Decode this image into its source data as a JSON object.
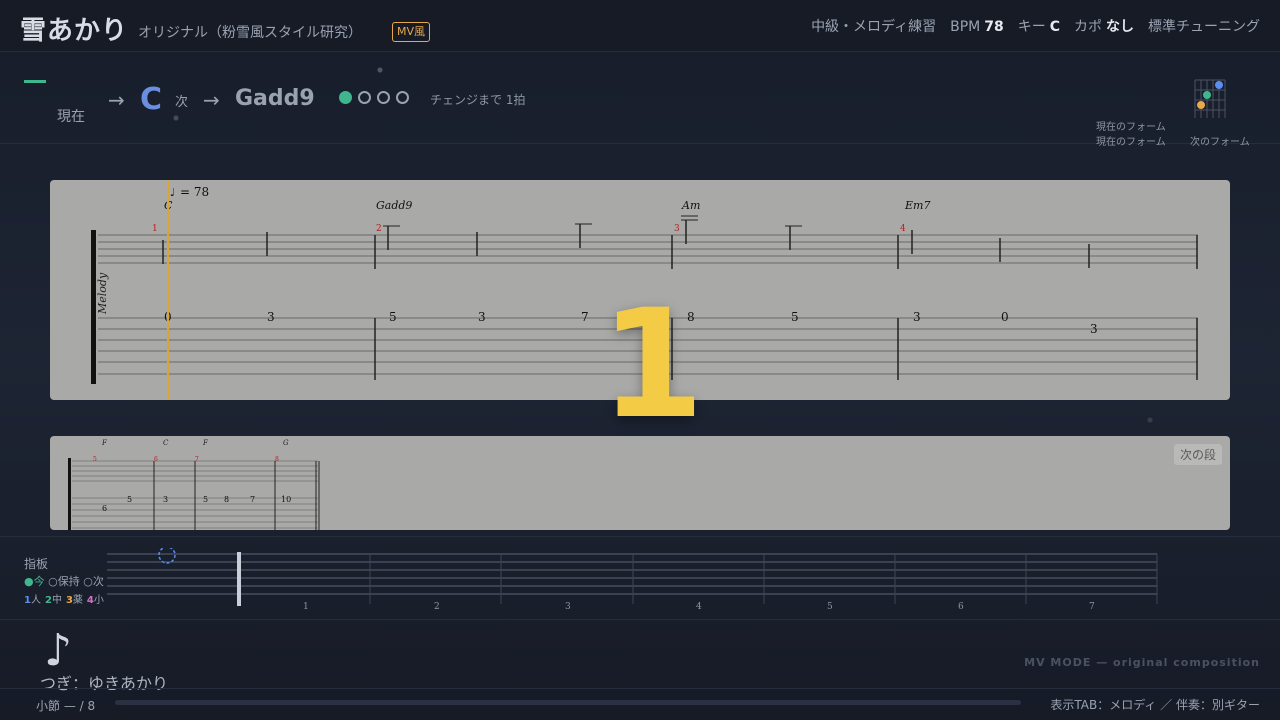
{
  "header": {
    "title": "雪あかり",
    "subtitle": "オリジナル（粉雪風スタイル研究）",
    "badge": "MV風",
    "level": "中級・メロディ練習",
    "bpm_label": "BPM",
    "bpm_value": "78",
    "key_label": "キー",
    "key_value": "C",
    "capo_label": "カポ",
    "capo_value": "なし",
    "tuning": "標準チューニング"
  },
  "chord_row": {
    "current_label": "現在",
    "arrow": "→",
    "current_chord": "C",
    "next_label": "次",
    "next_chord": "Gadd9",
    "beats_on": 1,
    "beats_total": 4,
    "change_text": "チェンジまで 1拍",
    "form_current": "現在のフォーム",
    "form_next": "次のフォーム"
  },
  "sheet1": {
    "tempo_text": "= 78",
    "track_label": "Melody",
    "chords": [
      "C",
      "Gadd9",
      "Am",
      "Em7"
    ],
    "measure_numbers": [
      "1",
      "2",
      "3",
      "4"
    ],
    "frets": [
      "0",
      "3",
      "5",
      "3",
      "7",
      "8",
      "5",
      "3",
      "0",
      "3"
    ]
  },
  "sheet2": {
    "chords": [
      "F",
      "C",
      "F",
      "G"
    ],
    "measure_numbers": [
      "5",
      "6",
      "7",
      "8"
    ],
    "frets": [
      "6",
      "5",
      "3",
      "5",
      "8",
      "7",
      "10"
    ],
    "next_label": "次の段"
  },
  "countdown": "1",
  "fretboard": {
    "label": "指板",
    "legend_now": "●今",
    "legend_hold": "○保持",
    "legend_next": "○次",
    "fingers": [
      {
        "num": "1",
        "name": "人",
        "color": "#5b8df0"
      },
      {
        "num": "2",
        "name": "中",
        "color": "#3fb68d"
      },
      {
        "num": "3",
        "name": "薬",
        "color": "#e7a84a"
      },
      {
        "num": "4",
        "name": "小",
        "color": "#d66fd0"
      }
    ],
    "fret_numbers": [
      "1",
      "2",
      "3",
      "4",
      "5",
      "6",
      "7"
    ]
  },
  "footer": {
    "note_icon": "♪",
    "credit": "つぎ：ゆきあかり",
    "mv_mode": "MV MODE — original composition",
    "measure": "小節 — / 8",
    "progress": 0,
    "tab_info": "表示TAB：メロディ ／ 伴奏：別ギター"
  }
}
